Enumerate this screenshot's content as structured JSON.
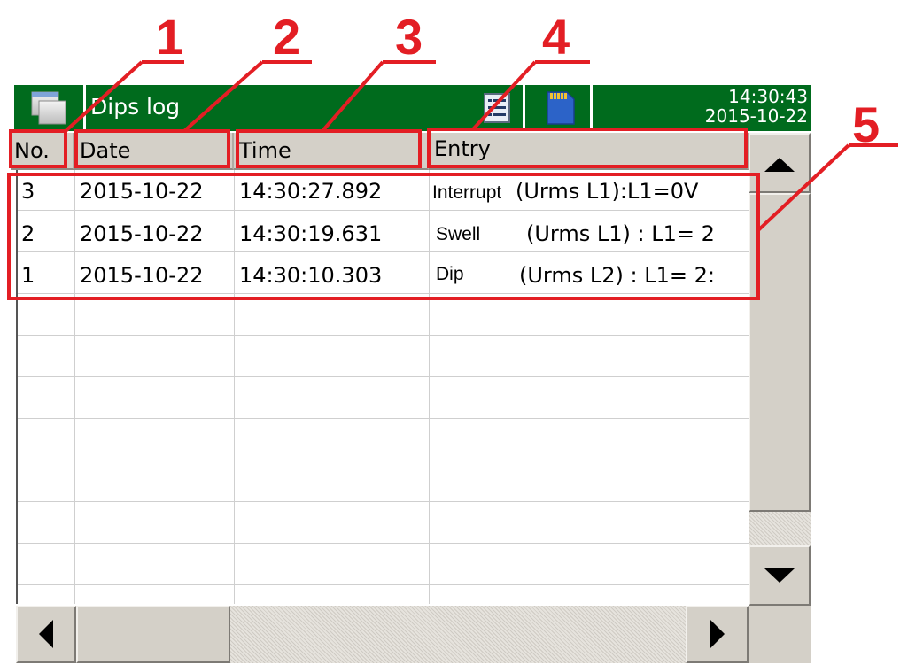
{
  "callouts": [
    "1",
    "2",
    "3",
    "4",
    "5"
  ],
  "titlebar": {
    "title": "Dips log",
    "time": "14:30:43",
    "date": "2015-10-22",
    "icons": [
      "window-icon",
      "list-view-icon",
      "sd-card-icon"
    ]
  },
  "table": {
    "headers": [
      "No.",
      "Date",
      "Time",
      "Entry"
    ],
    "rows": [
      {
        "no": "3",
        "date": "2015-10-22",
        "time": "14:30:27.892",
        "event": "Interrupt",
        "detail": "(Urms L1):L1=0V"
      },
      {
        "no": "2",
        "date": "2015-10-22",
        "time": "14:30:19.631",
        "event": "Swell",
        "detail": "(Urms L1) : L1= 2"
      },
      {
        "no": "1",
        "date": "2015-10-22",
        "time": "14:30:10.303",
        "event": "Dip",
        "detail": "(Urms L2) : L1= 2:"
      }
    ]
  },
  "scroll_icons": [
    "arrow-up-icon",
    "arrow-down-icon",
    "arrow-left-icon",
    "arrow-right-icon"
  ],
  "colors": {
    "titlebar": "#006b1d",
    "callout": "#e31e24",
    "header": "#d4d0c8"
  }
}
